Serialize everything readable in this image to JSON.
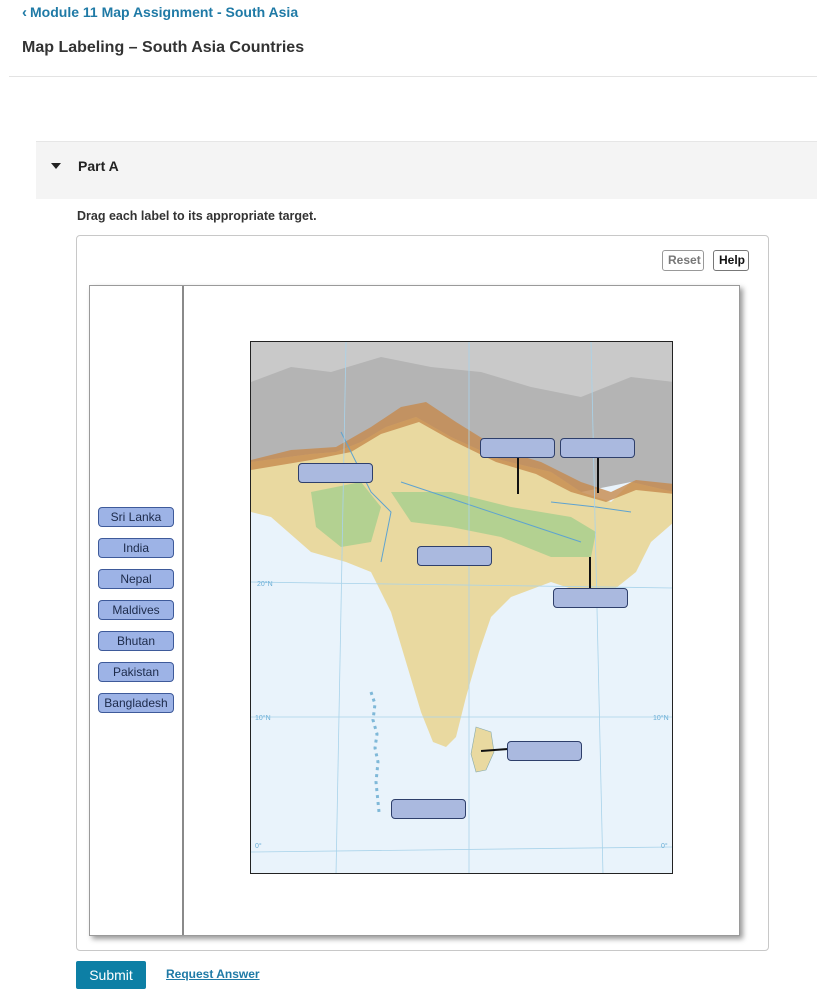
{
  "nav": {
    "back_label": "Module 11 Map Assignment - South Asia"
  },
  "page": {
    "title": "Map Labeling – South Asia Countries"
  },
  "part": {
    "label": "Part A",
    "instruction": "Drag each label to its appropriate target."
  },
  "toolbar": {
    "reset_label": "Reset",
    "help_label": "Help"
  },
  "labels": [
    "Sri Lanka",
    "India",
    "Nepal",
    "Maldives",
    "Bhutan",
    "Pakistan",
    "Bangladesh"
  ],
  "map": {
    "latitude_labels": [
      "20°N",
      "10°N",
      "10°N",
      "0°",
      "0°"
    ],
    "colors": {
      "ocean": "#e9f3fb",
      "lowland": "#a9cf8e",
      "plateau": "#e9d9a0",
      "mountain": "#c58a4e",
      "high_terrain": "#b4b4b4",
      "target": "#aab9df"
    }
  },
  "actions": {
    "submit_label": "Submit",
    "request_answer_label": "Request Answer"
  }
}
